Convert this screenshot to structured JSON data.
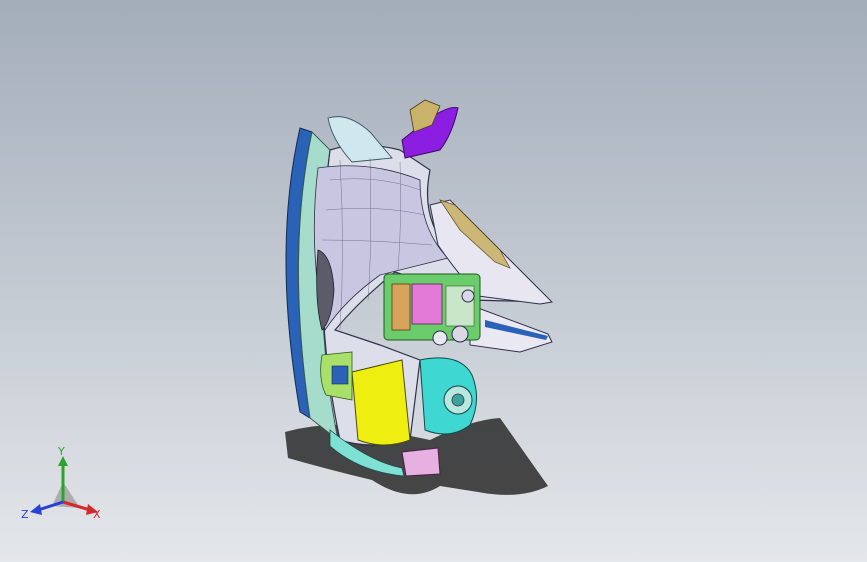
{
  "viewport": {
    "model_name": "",
    "background_top": "#a3adba",
    "background_bottom": "#e4e7eb"
  },
  "triad": {
    "x_label": "X",
    "y_label": "Y",
    "z_label": "Z",
    "x_color": "#d42a2a",
    "y_color": "#2aa52a",
    "z_color": "#2a3fd4"
  },
  "model": {
    "icon": "car-headlamp-assembly-model",
    "colors": {
      "housing": "#d9dbe8",
      "lens_edge": "#2a62b8",
      "bezel": "#9fd9c8",
      "reflector_yellow": "#eeee10",
      "cyan_part": "#3fd7d2",
      "purple_part": "#8b1ee0",
      "pink_part": "#e37ad8",
      "green_frame": "#4cc04c",
      "tan_part": "#c9b36a",
      "shadow": "#1c1c1c"
    }
  }
}
